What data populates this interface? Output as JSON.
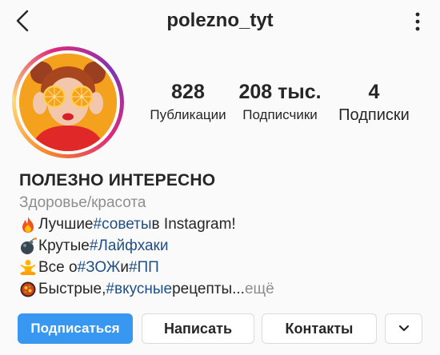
{
  "header": {
    "username": "polezno_tyt",
    "back_icon": "chevron-left-icon",
    "more_icon": "more-vertical-icon"
  },
  "stats": [
    {
      "value": "828",
      "label": "Публикации"
    },
    {
      "value": "208 тыс.",
      "label": "Подписчики"
    },
    {
      "value": "4",
      "label": "Подписки"
    }
  ],
  "bio": {
    "name": "ПОЛЕЗНО ИНТЕРЕСНО",
    "category": "Здоровье/красота",
    "lines": [
      {
        "emoji": "fire-emoji",
        "pre": "Лучшие ",
        "tag": "#советы",
        "post": " в Instagram!"
      },
      {
        "emoji": "bomb-emoji",
        "pre": "Крутые ",
        "tag": "#Лайфхаки",
        "post": ""
      },
      {
        "emoji": "lotus-position-emoji",
        "pre": "Все о ",
        "tag": "#ЗОЖ",
        "mid": " и ",
        "tag2": "#ПП"
      },
      {
        "emoji": "pan-food-emoji",
        "pre": "Быстрые, ",
        "tag": "#вкусные",
        "post": " рецепты...",
        "more": " ещё"
      }
    ]
  },
  "buttons": {
    "follow": "Подписаться",
    "message": "Написать",
    "contacts": "Контакты",
    "dropdown_icon": "chevron-down-icon"
  },
  "colors": {
    "accent": "#3897f0",
    "hashtag": "#1f4f85",
    "muted": "#8e8e8e"
  }
}
